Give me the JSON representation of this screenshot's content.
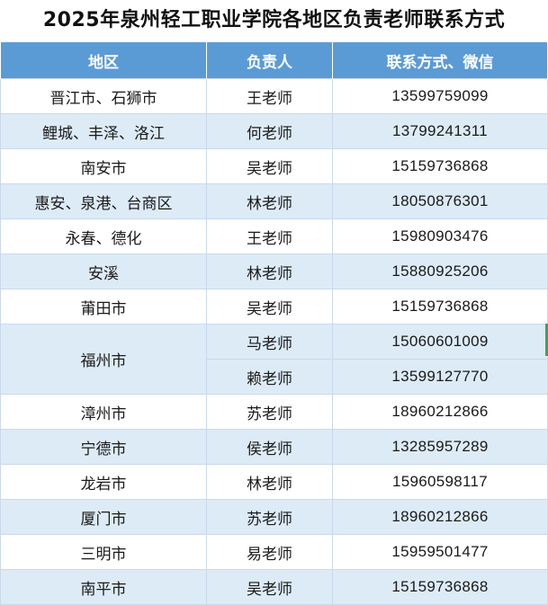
{
  "title": "2025年泉州轻工职业学院各地区负责老师联系方式",
  "headers": {
    "region": "地区",
    "owner": "负责人",
    "contact": "联系方式、微信"
  },
  "rows": [
    {
      "region": "晋江市、石狮市",
      "owner": "王老师",
      "phone": "13599759099"
    },
    {
      "region": "鲤城、丰泽、洛江",
      "owner": "何老师",
      "phone": "13799241311"
    },
    {
      "region": "南安市",
      "owner": "吴老师",
      "phone": "15159736868"
    },
    {
      "region": "惠安、泉港、台商区",
      "owner": "林老师",
      "phone": "18050876301"
    },
    {
      "region": "永春、德化",
      "owner": "王老师",
      "phone": "15980903476"
    },
    {
      "region": "安溪",
      "owner": "林老师",
      "phone": "15880925206"
    },
    {
      "region": "莆田市",
      "owner": "吴老师",
      "phone": "15159736868"
    },
    {
      "region": "福州市",
      "owner": "马老师",
      "phone": "15060601009"
    },
    {
      "region": "",
      "owner": "赖老师",
      "phone": "13599127770"
    },
    {
      "region": "漳州市",
      "owner": "苏老师",
      "phone": "18960212866"
    },
    {
      "region": "宁德市",
      "owner": "侯老师",
      "phone": "13285957289"
    },
    {
      "region": "龙岩市",
      "owner": "林老师",
      "phone": "15960598117"
    },
    {
      "region": "厦门市",
      "owner": "苏老师",
      "phone": "18960212866"
    },
    {
      "region": "三明市",
      "owner": "易老师",
      "phone": "15959501477"
    },
    {
      "region": "南平市",
      "owner": "吴老师",
      "phone": "15159736868"
    }
  ]
}
